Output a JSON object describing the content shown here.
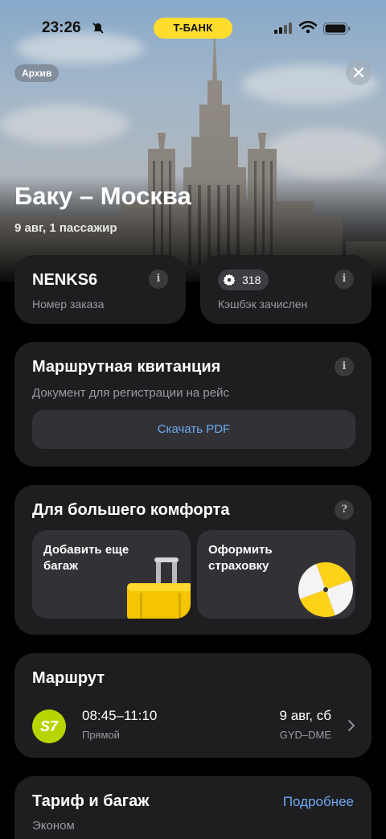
{
  "status_bar": {
    "time": "23:26",
    "bank": "T-БАНК"
  },
  "header": {
    "archive_badge": "Архив",
    "title": "Баку – Москва",
    "subtitle": "9 авг, 1 пассажир"
  },
  "order": {
    "code": "NENKS6",
    "label": "Номер заказа",
    "info_glyph": "i"
  },
  "cashback": {
    "amount": "318",
    "label": "Кэшбэк зачислен",
    "info_glyph": "i"
  },
  "itinerary": {
    "title": "Маршрутная квитанция",
    "subtitle": "Документ для регистрации на рейс",
    "button": "Скачать PDF",
    "info_glyph": "i"
  },
  "comfort": {
    "title": "Для большего комфорта",
    "help_glyph": "?",
    "tiles": [
      {
        "label": "Добавить еще багаж",
        "icon": "suitcase-icon"
      },
      {
        "label": "Оформить страховку",
        "icon": "umbrella-icon"
      }
    ]
  },
  "route": {
    "title": "Маршрут",
    "airline_logo": "S7",
    "times": "08:45–11:10",
    "type": "Прямой",
    "date": "9 авг, сб",
    "codes": "GYD–DME"
  },
  "tariff": {
    "title": "Тариф и багаж",
    "link": "Подробнее",
    "class": "Эконом"
  },
  "colors": {
    "accent_yellow": "#ffdd2d",
    "link_blue": "#6fa9f0",
    "card_bg": "#1e1e20",
    "s7_green": "#b7d600"
  }
}
